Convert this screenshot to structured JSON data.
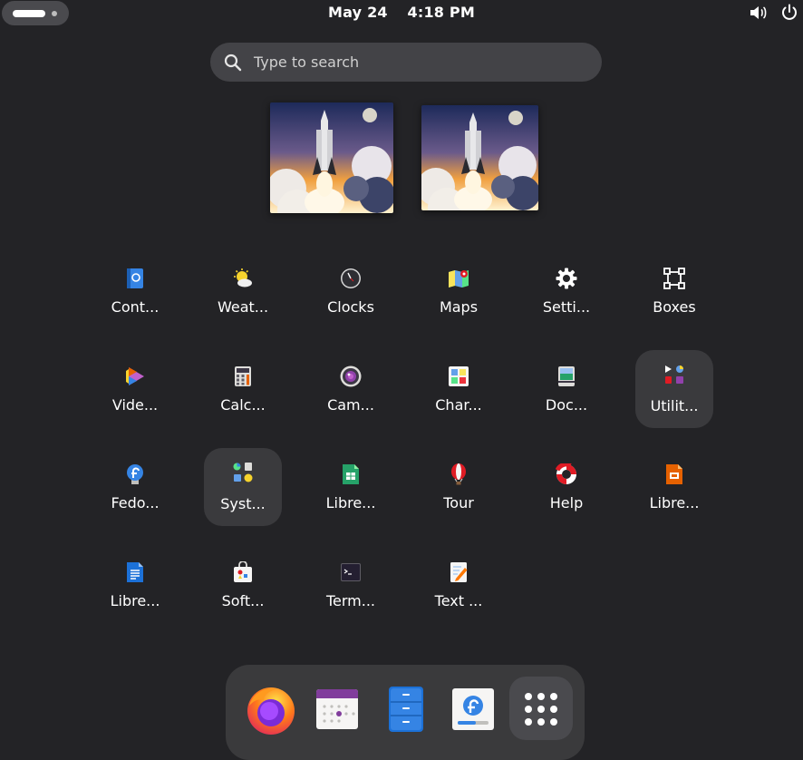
{
  "topbar": {
    "date": "May 24",
    "time": "4:18 PM"
  },
  "search": {
    "placeholder": "Type to search"
  },
  "apps": [
    {
      "label": "Cont...",
      "icon": "contacts-icon"
    },
    {
      "label": "Weat...",
      "icon": "weather-icon"
    },
    {
      "label": "Clocks",
      "icon": "clocks-icon"
    },
    {
      "label": "Maps",
      "icon": "maps-icon"
    },
    {
      "label": "Setti...",
      "icon": "settings-gear-icon"
    },
    {
      "label": "Boxes",
      "icon": "boxes-icon"
    },
    {
      "label": "Vide...",
      "icon": "videos-icon"
    },
    {
      "label": "Calc...",
      "icon": "calculator-icon"
    },
    {
      "label": "Cam...",
      "icon": "camera-icon"
    },
    {
      "label": "Char...",
      "icon": "characters-icon"
    },
    {
      "label": "Doc...",
      "icon": "document-scanner-icon"
    },
    {
      "label": "Utilit...",
      "icon": "utilities-folder-icon"
    },
    {
      "label": "Fedo...",
      "icon": "fedora-media-writer-icon"
    },
    {
      "label": "Syst...",
      "icon": "system-folder-icon"
    },
    {
      "label": "Libre...",
      "icon": "libreoffice-calc-icon"
    },
    {
      "label": "Tour",
      "icon": "tour-balloon-icon"
    },
    {
      "label": "Help",
      "icon": "help-lifebuoy-icon"
    },
    {
      "label": "Libre...",
      "icon": "libreoffice-impress-icon"
    },
    {
      "label": "Libre...",
      "icon": "libreoffice-writer-icon"
    },
    {
      "label": "Soft...",
      "icon": "software-icon"
    },
    {
      "label": "Term...",
      "icon": "terminal-icon"
    },
    {
      "label": "Text ...",
      "icon": "text-editor-icon"
    }
  ],
  "dock": [
    {
      "icon": "firefox-icon"
    },
    {
      "icon": "calendar-icon"
    },
    {
      "icon": "files-icon"
    },
    {
      "icon": "fedora-installer-icon"
    },
    {
      "icon": "show-apps-grid-icon"
    }
  ]
}
